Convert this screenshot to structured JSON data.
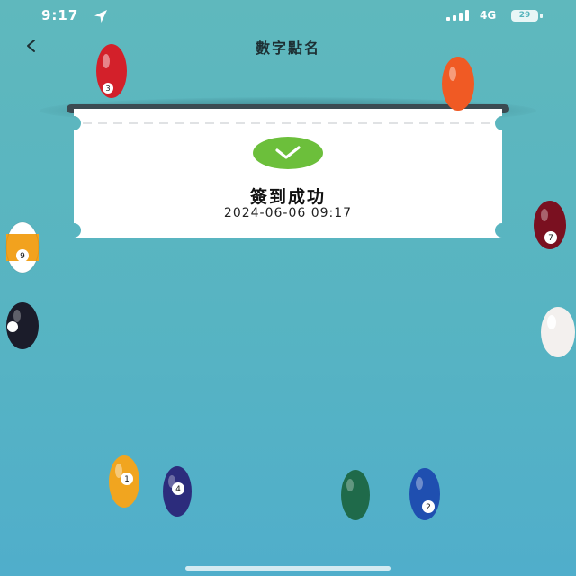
{
  "status_bar": {
    "time": "9:17",
    "network": "4G",
    "battery": "29"
  },
  "nav": {
    "back_label": "<",
    "title": "數字點名"
  },
  "ticket": {
    "status_text": "簽到成功",
    "timestamp": "2024-06-06 09:17",
    "check_color": "#6cbf3b"
  },
  "balls": [
    {
      "name": "ball-3-red",
      "color": "#d3202a",
      "label": "3"
    },
    {
      "name": "ball-orange-top",
      "color": "#f05a24",
      "label": ""
    },
    {
      "name": "ball-7-maroon",
      "color": "#7a1020",
      "label": "7"
    },
    {
      "name": "ball-9-yellow",
      "color": "#f2a21e",
      "label": "9"
    },
    {
      "name": "ball-8-black",
      "color": "#1b1c2a",
      "label": "8"
    },
    {
      "name": "ball-cue-white",
      "color": "#f3f0ee",
      "label": ""
    },
    {
      "name": "ball-1-yellow",
      "color": "#f1a51f",
      "label": "1"
    },
    {
      "name": "ball-4-purple",
      "color": "#2c2c7c",
      "label": "4"
    },
    {
      "name": "ball-6-green",
      "color": "#1f6a4a",
      "label": ""
    },
    {
      "name": "ball-2-blue",
      "color": "#1f4fb0",
      "label": "2"
    }
  ]
}
